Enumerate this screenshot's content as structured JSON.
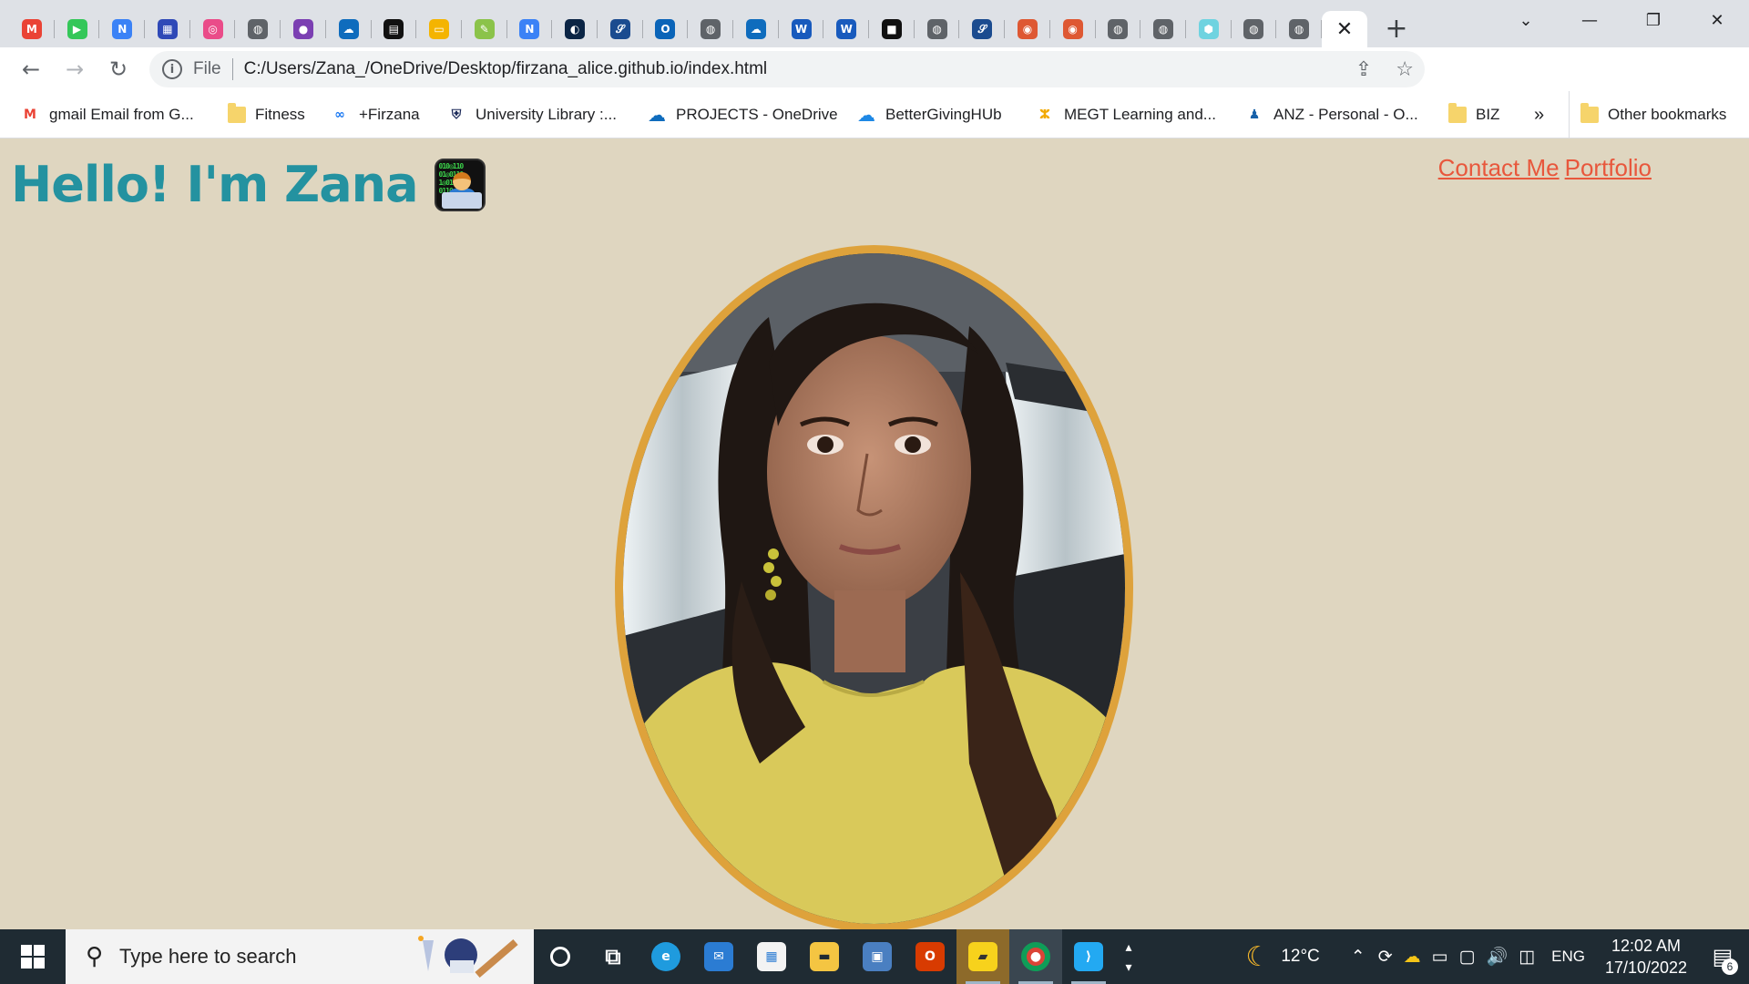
{
  "browser": {
    "tabs": [
      {
        "icon": "gmail-icon",
        "letter": "M",
        "color": "#ea4335"
      },
      {
        "icon": "play-icon",
        "letter": "▶",
        "color": "#34c759"
      },
      {
        "icon": "n-icon",
        "letter": "N",
        "color": "#3b82f6"
      },
      {
        "icon": "chart-icon",
        "letter": "▦",
        "color": "#2f49b7"
      },
      {
        "icon": "dribbble-icon",
        "letter": "◎",
        "color": "#ea4c89"
      },
      {
        "icon": "globe-icon",
        "letter": "◍",
        "color": "#5f6368"
      },
      {
        "icon": "purple-icon",
        "letter": "●",
        "color": "#7b3fb2"
      },
      {
        "icon": "onedrive-icon",
        "letter": "☁",
        "color": "#0f6cbd"
      },
      {
        "icon": "grid-icon",
        "letter": "▤",
        "color": "#111111"
      },
      {
        "icon": "yellow-icon",
        "letter": "▭",
        "color": "#f4b400"
      },
      {
        "icon": "leaf-icon",
        "letter": "✎",
        "color": "#8bc34a"
      },
      {
        "icon": "n-icon",
        "letter": "N",
        "color": "#3b82f6"
      },
      {
        "icon": "half-circle-icon",
        "letter": "◐",
        "color": "#0b2545"
      },
      {
        "icon": "script-icon",
        "letter": "𝒮",
        "color": "#1b4b8f"
      },
      {
        "icon": "outlook-icon",
        "letter": "O",
        "color": "#0a64b8"
      },
      {
        "icon": "globe-icon",
        "letter": "◍",
        "color": "#5f6368"
      },
      {
        "icon": "onedrive-icon",
        "letter": "☁",
        "color": "#0f6cbd"
      },
      {
        "icon": "word-icon",
        "letter": "W",
        "color": "#185abd"
      },
      {
        "icon": "word-icon",
        "letter": "W",
        "color": "#185abd"
      },
      {
        "icon": "dark-icon",
        "letter": "■",
        "color": "#111111"
      },
      {
        "icon": "globe-icon",
        "letter": "◍",
        "color": "#5f6368"
      },
      {
        "icon": "script-icon",
        "letter": "𝒮",
        "color": "#1b4b8f"
      },
      {
        "icon": "duckduckgo-icon",
        "letter": "◉",
        "color": "#de5833"
      },
      {
        "icon": "duckduckgo-icon",
        "letter": "◉",
        "color": "#de5833"
      },
      {
        "icon": "globe-icon",
        "letter": "◍",
        "color": "#5f6368"
      },
      {
        "icon": "globe-icon",
        "letter": "◍",
        "color": "#5f6368"
      },
      {
        "icon": "hexagon-icon",
        "letter": "⬢",
        "color": "#6fd3e0"
      },
      {
        "icon": "globe-icon",
        "letter": "◍",
        "color": "#5f6368"
      },
      {
        "icon": "globe-icon",
        "letter": "◍",
        "color": "#5f6368"
      }
    ],
    "active_tab_close": "✕",
    "new_tab": "+",
    "omnibox": {
      "scheme_label": "File",
      "url": "C:/Users/Zana_/OneDrive/Desktop/firzana_alice.github.io/index.html"
    },
    "bookmarks": [
      {
        "label": "gmail Email from G...",
        "icon": "gmail-icon"
      },
      {
        "label": "Fitness",
        "icon": "folder-icon"
      },
      {
        "label": "+Firzana",
        "icon": "meta-icon"
      },
      {
        "label": "University Library :...",
        "icon": "crest-icon"
      },
      {
        "label": "PROJECTS - OneDrive",
        "icon": "onedrive-icon"
      },
      {
        "label": "BetterGivingHUb",
        "icon": "cloud-icon"
      },
      {
        "label": "MEGT Learning and...",
        "icon": "megt-icon"
      },
      {
        "label": "ANZ - Personal - O...",
        "icon": "anz-icon"
      },
      {
        "label": "BIZ",
        "icon": "folder-icon"
      }
    ],
    "bookmarks_overflow": "»",
    "other_bookmarks": "Other bookmarks"
  },
  "page": {
    "heading": "Hello! I'm Zana",
    "nav": {
      "contact": "Contact Me",
      "portfolio": "Portfolio"
    },
    "colors": {
      "background": "#dfd6c0",
      "heading": "#2492a0",
      "link": "#e8573c",
      "photo_border": "#dea23b"
    }
  },
  "taskbar": {
    "search_placeholder": "Type here to search",
    "weather": "12°C",
    "language": "ENG",
    "time": "12:02 AM",
    "date": "17/10/2022",
    "notifications": "6"
  }
}
